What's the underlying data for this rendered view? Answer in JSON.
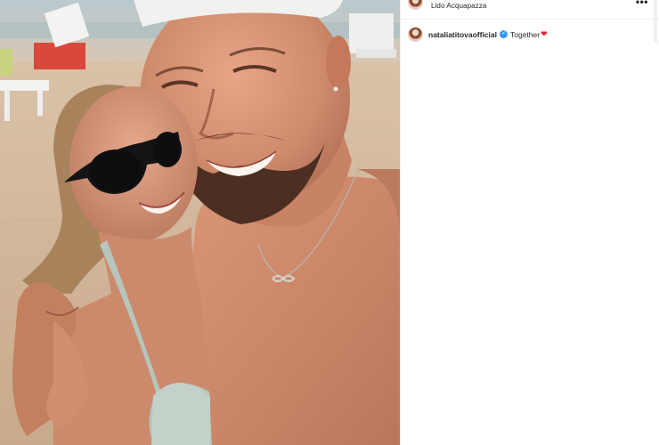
{
  "post": {
    "location": "Lido Acquapazza",
    "more_icon": "more-horizontal-icon",
    "caption": {
      "username": "nataliatitovaofficial",
      "verified_icon": "verified-badge-icon",
      "text": "Together",
      "emoji": "❤"
    }
  },
  "colors": {
    "verified": "#3897f0",
    "heart": "#e0242f",
    "text": "#262626"
  }
}
